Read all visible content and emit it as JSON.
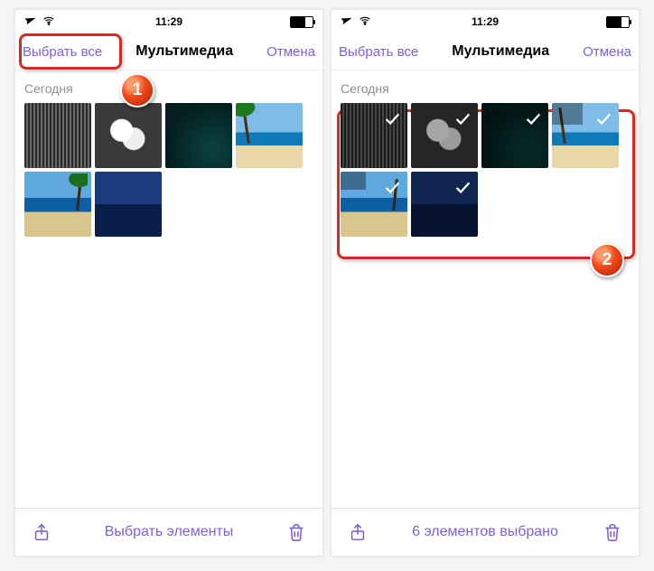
{
  "statusbar": {
    "time": "11:29"
  },
  "nav": {
    "select_all": "Выбрать все",
    "title": "Мультимедиа",
    "cancel": "Отмена"
  },
  "section": {
    "today": "Сегодня"
  },
  "toolbar": {
    "left_unselected": "Выбрать элементы",
    "right_selected": "6 элементов выбрано"
  },
  "badges": {
    "one": "1",
    "two": "2"
  },
  "thumbs": [
    "spikes",
    "dice",
    "rock",
    "palm",
    "beach2",
    "bluedune"
  ]
}
